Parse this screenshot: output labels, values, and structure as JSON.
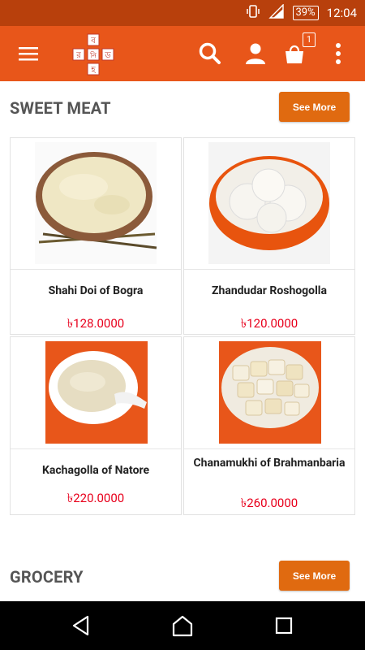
{
  "status_bar": {
    "battery": "39%",
    "time": "12:04"
  },
  "app_bar": {
    "logo_letters": [
      "ব",
      "র",
      "নি",
      "ড",
      "হ"
    ],
    "cart_count": "1",
    "icons": [
      "menu-icon",
      "search-icon",
      "user-icon",
      "cart-icon",
      "more-vert-icon"
    ]
  },
  "sections": [
    {
      "title": "SWEET MEAT",
      "see_more_label": "See More",
      "products": [
        {
          "name": "Shahi Doi of Bogra",
          "price": "৳128.0000"
        },
        {
          "name": "Zhandudar Roshogolla",
          "price": "৳120.0000"
        },
        {
          "name": "Kachagolla of Natore",
          "price": "৳220.0000"
        },
        {
          "name": "Chanamukhi of Brahmanbaria",
          "price": "৳260.0000"
        }
      ]
    },
    {
      "title": "GROCERY",
      "see_more_label": "See More"
    }
  ],
  "nav_bar": {
    "icons": [
      "back-icon",
      "home-icon",
      "recents-icon"
    ]
  },
  "colors": {
    "status_bar": "#b8400c",
    "app_bar": "#e8561a",
    "button": "#e06a10",
    "price": "#e8001c"
  }
}
